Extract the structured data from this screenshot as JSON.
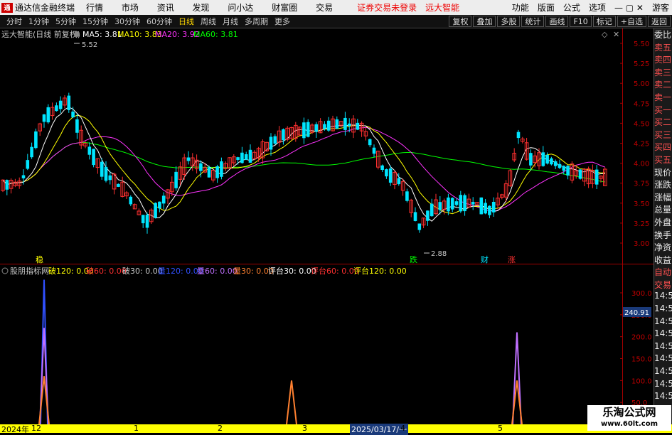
{
  "app": {
    "logo": "通",
    "title": "通达信金融终端",
    "warn1": "证券交易未登录",
    "warn2": "远大智能"
  },
  "menu": [
    "行情",
    "市场",
    "资讯",
    "发现",
    "问小达",
    "财富圈",
    "交易"
  ],
  "right_menu": [
    "功能",
    "版面",
    "公式",
    "选项",
    "游客"
  ],
  "periods": [
    "分时",
    "1分钟",
    "5分钟",
    "15分钟",
    "30分钟",
    "60分钟",
    "日线",
    "周线",
    "月线",
    "多周期",
    "更多"
  ],
  "active_period": "日线",
  "tools": [
    "复权",
    "叠加",
    "多股",
    "统计",
    "画线",
    "F10",
    "标记",
    "+自选",
    "返回"
  ],
  "main_header": {
    "stock": "远大智能(日线 前复权)",
    "ma5": "MA5: 3.81",
    "ma10": "MA10: 3.83",
    "ma20": "MA20: 3.92",
    "ma60": "MA60: 3.81"
  },
  "ind_header": {
    "name": "股朋指标网",
    "items": [
      "破120: 0.00",
      "破60: 0.00",
      "破30: 0.00",
      "量120: 0.00",
      "量60: 0.00",
      "量30: 0.00",
      "评台30: 0.00",
      "评台60: 0.00",
      "评台120: 0.00"
    ]
  },
  "right_panel": [
    "委比",
    "卖五",
    "卖四",
    "卖三",
    "卖二",
    "卖一",
    "买一",
    "买二",
    "买三",
    "买四",
    "买五",
    "现价",
    "涨跌",
    "涨幅",
    "总量",
    "外盘",
    "换手",
    "净资",
    "收益",
    "自动",
    "交易",
    "14:56",
    "14:56",
    "14:56",
    "14:56",
    "14:56",
    "14:56",
    "14:56",
    "14:56",
    "14:56"
  ],
  "markers": {
    "high": "5.52",
    "low": "2.88",
    "m1": "稳",
    "m2": "跌",
    "m3": "财",
    "m4": "涨"
  },
  "ind_current": "240.91",
  "date_axis": [
    "2024年",
    "12",
    "1",
    "2",
    "3",
    "2025/03/17/一",
    "4",
    "5"
  ],
  "watermark": {
    "line1": "乐淘公式网",
    "line2": "www.60lt.com"
  },
  "colors": {
    "up": "#ff3030",
    "down": "#00e5ff",
    "ma5": "#ffffff",
    "ma10": "#ffff00",
    "ma20": "#ff33ff",
    "ma60": "#00ff00"
  },
  "chart_data": {
    "type": "candlestick",
    "ylim": [
      2.9,
      5.6
    ],
    "y_ticks": [
      "5.50",
      "5.25",
      "5.00",
      "4.75",
      "4.50",
      "4.25",
      "4.00",
      "3.75",
      "3.50",
      "3.25",
      "3.00"
    ],
    "ind_ticks": [
      "300.0",
      "250.0",
      "200.0",
      "150.0",
      "100.0",
      "50.0"
    ],
    "ind_ylim": [
      0,
      350
    ]
  }
}
